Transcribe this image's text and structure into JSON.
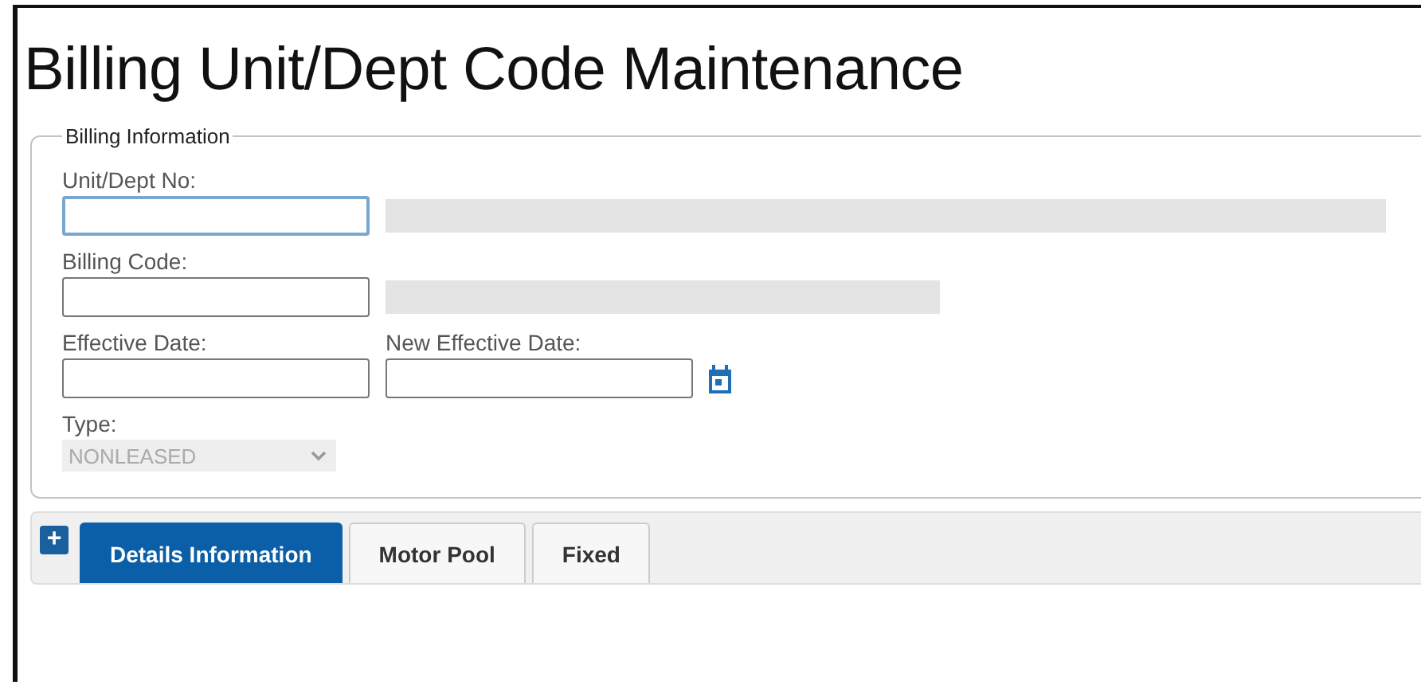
{
  "title": "Billing Unit/Dept Code Maintenance",
  "billing_information": {
    "legend": "Billing Information",
    "rows": [
      {
        "fields": [
          {
            "kind": "text",
            "label": "Unit/Dept No:",
            "focused": true
          },
          {
            "kind": "readonly"
          }
        ]
      },
      {
        "fields": [
          {
            "kind": "text",
            "label": "Billing Code:",
            "focused": false
          },
          {
            "kind": "readonly"
          }
        ]
      },
      {
        "fields": [
          {
            "kind": "text",
            "label": "Effective Date:",
            "focused": false
          },
          {
            "kind": "date",
            "label": "New Effective Date:",
            "focused": false
          }
        ]
      },
      {
        "fields": [
          {
            "kind": "select",
            "label": "Type:",
            "value": "NONLEASED",
            "disabled": true
          }
        ]
      }
    ]
  },
  "tabs": [
    {
      "label": "Details Information",
      "selected": true
    },
    {
      "label": "Motor Pool",
      "selected": false
    },
    {
      "label": "Fixed",
      "selected": false
    }
  ],
  "expand_button": {
    "label": "+"
  }
}
